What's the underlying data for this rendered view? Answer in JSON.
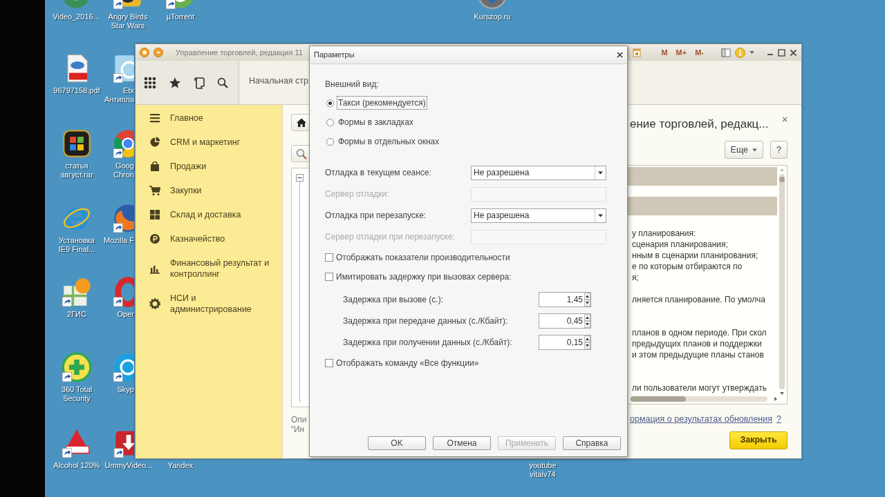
{
  "desktop_icons": [
    {
      "label": "Video_2016...",
      "kind": "video",
      "shortcut": false
    },
    {
      "label": "Angry Birds\nStar Wars",
      "kind": "game",
      "shortcut": true
    },
    {
      "label": "µTorrent",
      "kind": "torrent",
      "shortcut": true
    },
    {
      "label": "Kurszop.ru",
      "kind": "site",
      "shortcut": false
    },
    {
      "label": "96797158.pdf",
      "kind": "pdf",
      "shortcut": false
    },
    {
      "label": "Etx\nАнтипла",
      "kind": "app",
      "shortcut": true
    },
    {
      "label": "статья\nавгуст.rar",
      "kind": "archive",
      "shortcut": false
    },
    {
      "label": "Goog\nChron",
      "kind": "chrome",
      "shortcut": true
    },
    {
      "label": "Установка\nIE9 Final...",
      "kind": "ie",
      "shortcut": false
    },
    {
      "label": "Mozilla F",
      "kind": "firefox",
      "shortcut": true
    },
    {
      "label": "2ГИС",
      "kind": "map",
      "shortcut": true
    },
    {
      "label": "Oper",
      "kind": "opera",
      "shortcut": true
    },
    {
      "label": "360 Total\nSecurity",
      "kind": "plus",
      "shortcut": true
    },
    {
      "label": "Skyp",
      "kind": "skype",
      "shortcut": true
    },
    {
      "label": "Alcohol 120%",
      "kind": "alcohol",
      "shortcut": true
    },
    {
      "label": "UmmyVideo...",
      "kind": "download",
      "shortcut": true
    },
    {
      "label": "Yandex",
      "kind": "label"
    },
    {
      "label": "youtube\nvitalv74",
      "kind": "label"
    }
  ],
  "main_window": {
    "title": "Управление торговлей, редакция 11",
    "memory_buttons": [
      "M",
      "M+",
      "M-"
    ],
    "start_tab": "Начальная стр",
    "sections": [
      {
        "label": "Главное",
        "kind": "list"
      },
      {
        "label": "CRM и маркетинг",
        "kind": "pie"
      },
      {
        "label": "Продажи",
        "kind": "bag"
      },
      {
        "label": "Закупки",
        "kind": "cart"
      },
      {
        "label": "Склад и доставка",
        "kind": "grid"
      },
      {
        "label": "Казначейство",
        "kind": "coin"
      },
      {
        "label": "Финансовый результат и\nконтроллинг",
        "kind": "bars"
      },
      {
        "label": "НСИ и\nадминистрирование",
        "kind": "gear"
      }
    ],
    "left_fragments": [
      "Опи",
      "“Ин"
    ],
    "heading": "ение торговлей, редакц...",
    "more_button": "Еще",
    "help_button": "?",
    "panel_paragraphs": [
      [
        "у планирования:",
        "сценария планирования;",
        "нным в сценарии планирования;",
        "е по которым отбираются по",
        "я;"
      ],
      [
        "лняется планирование. По умолча"
      ],
      [
        "планов в одном периоде. При скол",
        "предыдущих планов и поддержки",
        "и этом предыдущие планы станов"
      ],
      [
        "ли пользователи могут  утверждать"
      ]
    ],
    "info_link": "ормация о результатах обновления",
    "info_help": "?",
    "close_button": "Закрыть"
  },
  "dialog": {
    "title": "Параметры",
    "appearance_label": "Внешний вид:",
    "appearance_options": [
      {
        "label": "Такси (рекомендуется)",
        "selected": true
      },
      {
        "label": "Формы в закладках",
        "selected": false
      },
      {
        "label": "Формы в отдельных окнах",
        "selected": false
      }
    ],
    "rows": [
      {
        "kind": "select",
        "label": "Отладка в текущем сеансе:",
        "value": "Не разрешена",
        "disabled": false
      },
      {
        "kind": "input",
        "label": "Сервер отладки:",
        "disabled": true
      },
      {
        "kind": "select",
        "label": "Отладка при перезапуске:",
        "value": "Не разрешена",
        "disabled": false
      },
      {
        "kind": "input",
        "label": "Сервер отладки при перезапуске:",
        "disabled": true
      },
      {
        "kind": "checkbox",
        "label": "Отображать показатели производительности",
        "checked": false
      },
      {
        "kind": "checkbox",
        "label": "Имитировать задержку при вызовах сервера:",
        "checked": false
      },
      {
        "kind": "spin",
        "label": "Задержка при вызове (с.):",
        "value": "1,45"
      },
      {
        "kind": "spin",
        "label": "Задержка при передаче данных (с./Кбайт):",
        "value": "0,45"
      },
      {
        "kind": "spin",
        "label": "Задержка при получении данных (с./Кбайт):",
        "value": "0,15"
      },
      {
        "kind": "checkbox",
        "label": "Отображать команду «Все функции»",
        "checked": false
      }
    ],
    "buttons": [
      {
        "label": "OK",
        "disabled": false
      },
      {
        "label": "Отмена",
        "disabled": false
      },
      {
        "label": "Применить",
        "disabled": true
      },
      {
        "label": "Справка",
        "disabled": false
      }
    ]
  }
}
